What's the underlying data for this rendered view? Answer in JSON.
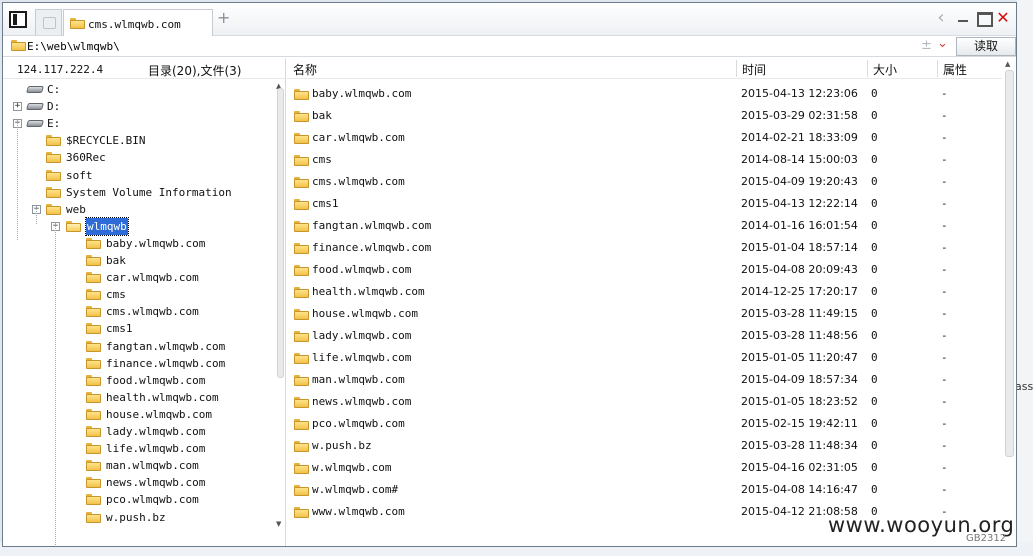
{
  "window": {
    "tab_title": "cms.wlmqwb.com"
  },
  "address": {
    "path": "E:\\web\\wlmqwb\\",
    "read_button": "读取"
  },
  "left": {
    "ip": "124.117.222.4",
    "counts": "目录(20),文件(3)",
    "tree": [
      {
        "label": "C:",
        "type": "drive"
      },
      {
        "label": "D:",
        "type": "drive",
        "expander": "+"
      },
      {
        "label": "E:",
        "type": "drive",
        "expander": "−"
      },
      {
        "label": "$RECYCLE.BIN",
        "type": "folder"
      },
      {
        "label": "360Rec",
        "type": "folder"
      },
      {
        "label": "soft",
        "type": "folder"
      },
      {
        "label": "System Volume Information",
        "type": "folder"
      },
      {
        "label": "web",
        "type": "folder",
        "expander": "−"
      },
      {
        "label": "wlmqwb",
        "type": "folder",
        "expander": "−",
        "selected": true
      },
      {
        "label": "baby.wlmqwb.com",
        "type": "folder"
      },
      {
        "label": "bak",
        "type": "folder"
      },
      {
        "label": "car.wlmqwb.com",
        "type": "folder"
      },
      {
        "label": "cms",
        "type": "folder"
      },
      {
        "label": "cms.wlmqwb.com",
        "type": "folder"
      },
      {
        "label": "cms1",
        "type": "folder"
      },
      {
        "label": "fangtan.wlmqwb.com",
        "type": "folder"
      },
      {
        "label": "finance.wlmqwb.com",
        "type": "folder"
      },
      {
        "label": "food.wlmqwb.com",
        "type": "folder"
      },
      {
        "label": "health.wlmqwb.com",
        "type": "folder"
      },
      {
        "label": "house.wlmqwb.com",
        "type": "folder"
      },
      {
        "label": "lady.wlmqwb.com",
        "type": "folder"
      },
      {
        "label": "life.wlmqwb.com",
        "type": "folder"
      },
      {
        "label": "man.wlmqwb.com",
        "type": "folder"
      },
      {
        "label": "news.wlmqwb.com",
        "type": "folder"
      },
      {
        "label": "pco.wlmqwb.com",
        "type": "folder"
      },
      {
        "label": "w.push.bz",
        "type": "folder"
      }
    ]
  },
  "right": {
    "columns": {
      "name": "名称",
      "time": "时间",
      "size": "大小",
      "attr": "属性"
    },
    "rows": [
      {
        "name": "baby.wlmqwb.com",
        "time": "2015-04-13 12:23:06",
        "size": "0",
        "attr": "-"
      },
      {
        "name": "bak",
        "time": "2015-03-29 02:31:58",
        "size": "0",
        "attr": "-"
      },
      {
        "name": "car.wlmqwb.com",
        "time": "2014-02-21 18:33:09",
        "size": "0",
        "attr": "-"
      },
      {
        "name": "cms",
        "time": "2014-08-14 15:00:03",
        "size": "0",
        "attr": "-"
      },
      {
        "name": "cms.wlmqwb.com",
        "time": "2015-04-09 19:20:43",
        "size": "0",
        "attr": "-"
      },
      {
        "name": "cms1",
        "time": "2015-04-13 12:22:14",
        "size": "0",
        "attr": "-"
      },
      {
        "name": "fangtan.wlmqwb.com",
        "time": "2014-01-16 16:01:54",
        "size": "0",
        "attr": "-"
      },
      {
        "name": "finance.wlmqwb.com",
        "time": "2015-01-04 18:57:14",
        "size": "0",
        "attr": "-"
      },
      {
        "name": "food.wlmqwb.com",
        "time": "2015-04-08 20:09:43",
        "size": "0",
        "attr": "-"
      },
      {
        "name": "health.wlmqwb.com",
        "time": "2014-12-25 17:20:17",
        "size": "0",
        "attr": "-"
      },
      {
        "name": "house.wlmqwb.com",
        "time": "2015-03-28 11:49:15",
        "size": "0",
        "attr": "-"
      },
      {
        "name": "lady.wlmqwb.com",
        "time": "2015-03-28 11:48:56",
        "size": "0",
        "attr": "-"
      },
      {
        "name": "life.wlmqwb.com",
        "time": "2015-01-05 11:20:47",
        "size": "0",
        "attr": "-"
      },
      {
        "name": "man.wlmqwb.com",
        "time": "2015-04-09 18:57:34",
        "size": "0",
        "attr": "-"
      },
      {
        "name": "news.wlmqwb.com",
        "time": "2015-01-05 18:23:52",
        "size": "0",
        "attr": "-"
      },
      {
        "name": "pco.wlmqwb.com",
        "time": "2015-02-15 19:42:11",
        "size": "0",
        "attr": "-"
      },
      {
        "name": "w.push.bz",
        "time": "2015-03-28 11:48:34",
        "size": "0",
        "attr": "-"
      },
      {
        "name": "w.wlmqwb.com",
        "time": "2015-04-16 02:31:05",
        "size": "0",
        "attr": "-"
      },
      {
        "name": "w.wlmqwb.com#",
        "time": "2015-04-08 14:16:47",
        "size": "0",
        "attr": "-"
      },
      {
        "name": "www.wlmqwb.com",
        "time": "2015-04-12 21:08:58",
        "size": "0",
        "attr": "-"
      }
    ]
  },
  "background": {
    "side_text": "ass",
    "watermark": "www.wooyun.org",
    "code": "GB2312"
  }
}
